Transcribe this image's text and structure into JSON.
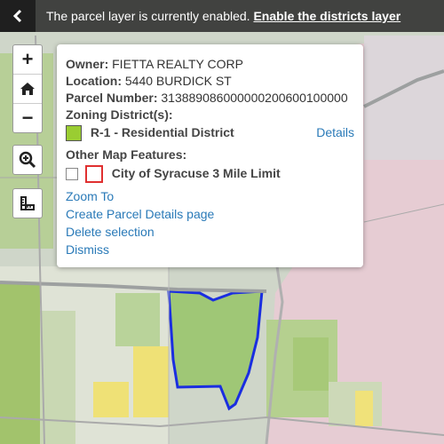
{
  "topbar": {
    "message": "The parcel layer is currently enabled.",
    "link": "Enable the districts layer"
  },
  "map_controls": {
    "zoom_in": "+",
    "zoom_out": "−"
  },
  "popup": {
    "owner_label": "Owner:",
    "owner_value": "FIETTA REALTY CORP",
    "location_label": "Location:",
    "location_value": "5440 BURDICK ST",
    "parcel_label": "Parcel Number:",
    "parcel_value": "313889086000000200600100000",
    "zoning_label": "Zoning District(s):",
    "zoning_value": "R-1 - Residential District",
    "zoning_color": "#9acd32",
    "details_link": "Details",
    "other_label": "Other Map Features:",
    "feature_label": "City of Syracuse 3 Mile Limit",
    "feature_color": "#e03030",
    "actions": {
      "zoom_to": "Zoom To",
      "create_page": "Create Parcel Details page",
      "delete_selection": "Delete selection",
      "dismiss": "Dismiss"
    }
  },
  "colors": {
    "parcel_outline": "#1a2ee0",
    "residential": "#a8c979",
    "commercial": "#f0e27a",
    "rural": "#e8cdd4"
  }
}
